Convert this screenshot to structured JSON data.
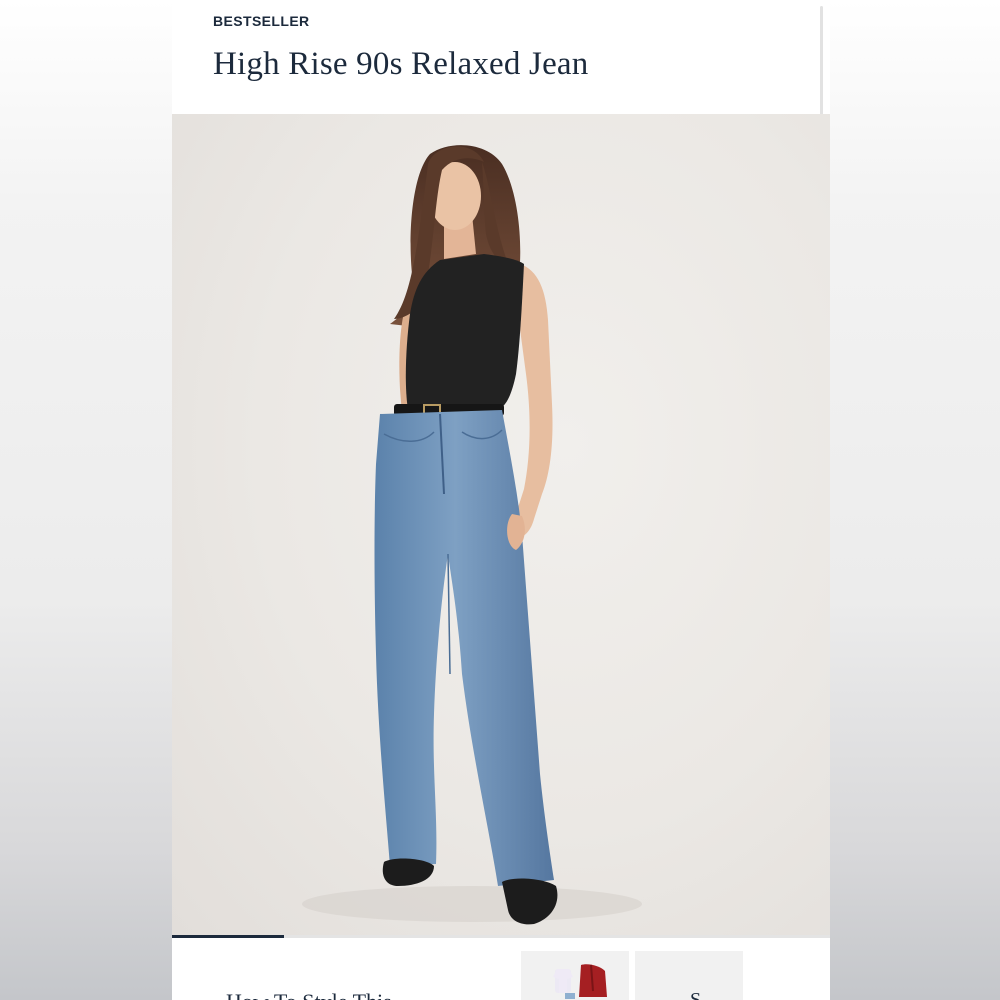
{
  "product": {
    "badge": "BESTSELLER",
    "title": "High Rise 90s Relaxed Jean"
  },
  "gallery": {
    "image_alt": "Model wearing High Rise 90s Relaxed Jean with black sleeveless top",
    "progress": 0.17
  },
  "styling": {
    "link_label": "How To Style This",
    "thumbnail_2_label": "S"
  },
  "colors": {
    "text_primary": "#1c2a3c",
    "background": "#ffffff",
    "denim": "#6f93b8",
    "top": "#1f1f1f"
  },
  "icons": {
    "carousel_next": "chevron-right-icon"
  }
}
